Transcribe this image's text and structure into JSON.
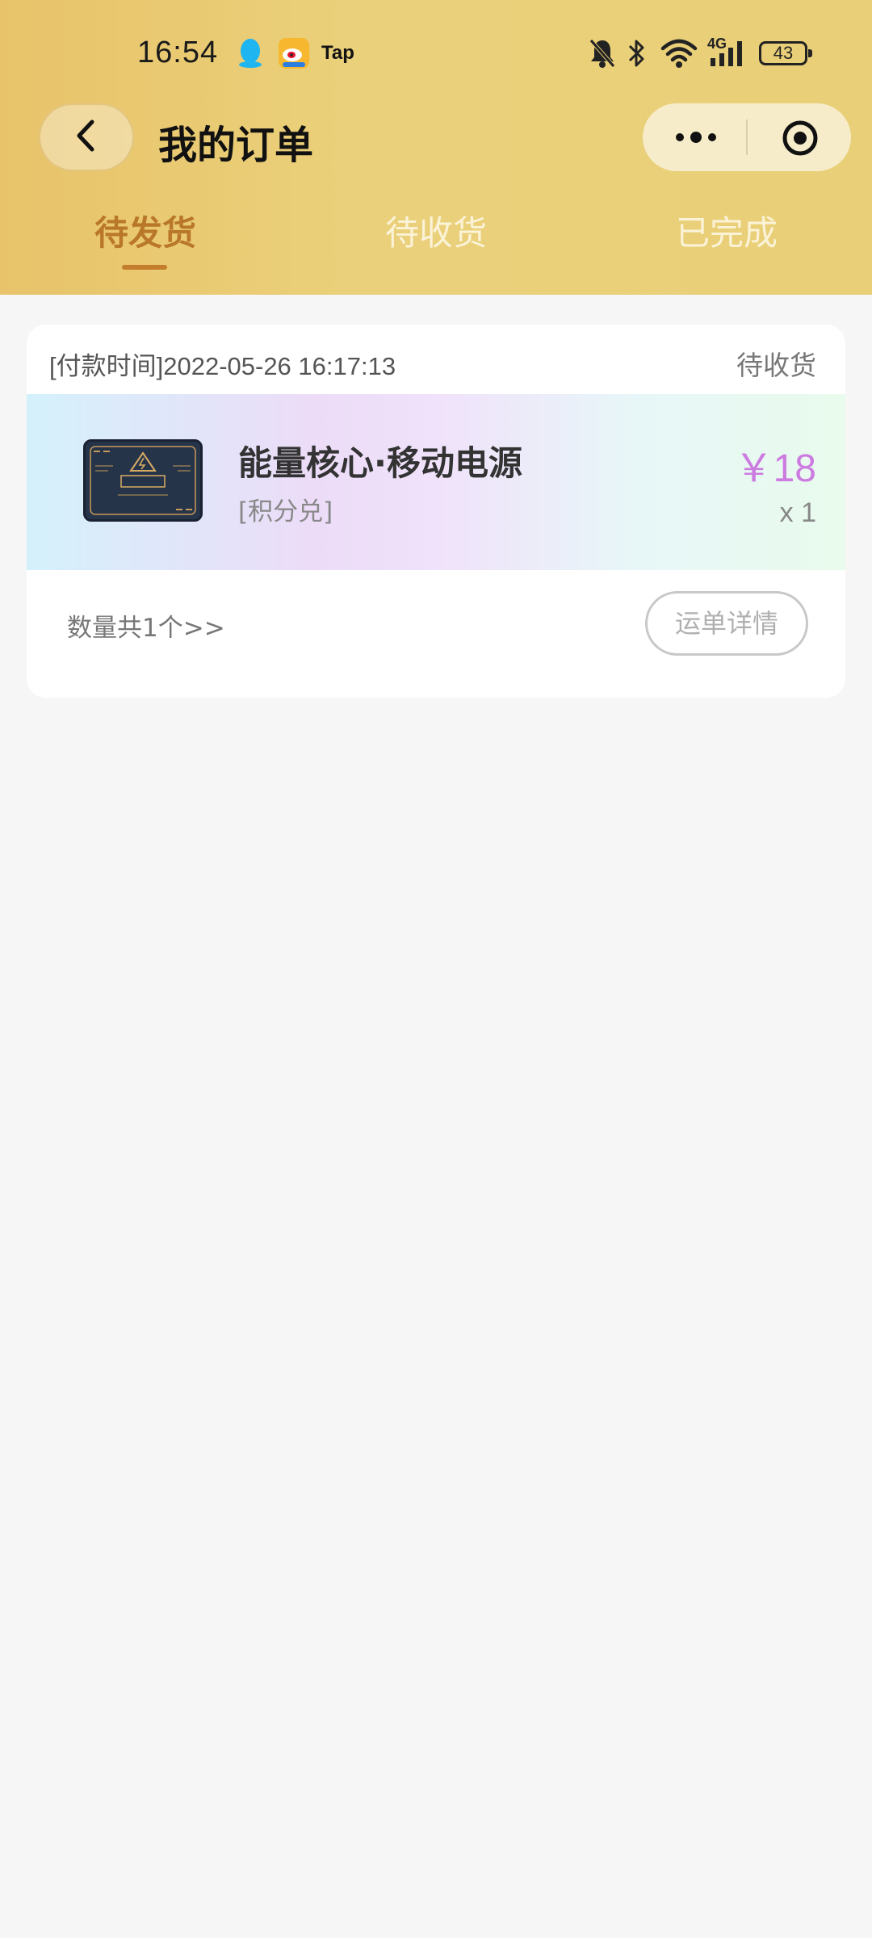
{
  "status_bar": {
    "time": "16:54",
    "notification_icons": [
      "qq-icon",
      "weibo-icon",
      "tap-icon"
    ],
    "tap_label": "Tap",
    "system_icons": [
      "mute-icon",
      "bluetooth-icon",
      "wifi-icon",
      "signal-4g-icon"
    ],
    "network_label": "4G",
    "battery_level": "43"
  },
  "nav": {
    "title": "我的订单",
    "back_icon": "chevron-left-icon",
    "capsule_icons": [
      "more-icon",
      "target-icon"
    ]
  },
  "tabs": [
    {
      "label": "待发货",
      "active": true
    },
    {
      "label": "待收货",
      "active": false
    },
    {
      "label": "已完成",
      "active": false
    }
  ],
  "order": {
    "pay_time": "[付款时间]2022-05-26 16:17:13",
    "status": "待收货",
    "product": {
      "name": "能量核心·移动电源",
      "tag": "[积分兑]",
      "price": "￥18",
      "quantity": "x 1"
    },
    "count_text": "数量共1个>>",
    "waybill_button": "运单详情"
  },
  "colors": {
    "header_bg": "#e9cd77",
    "active_tab": "#b9772a",
    "inactive_tab": "#fbf3d8",
    "price": "#cc7be0",
    "page_bg": "#f6f6f6"
  }
}
